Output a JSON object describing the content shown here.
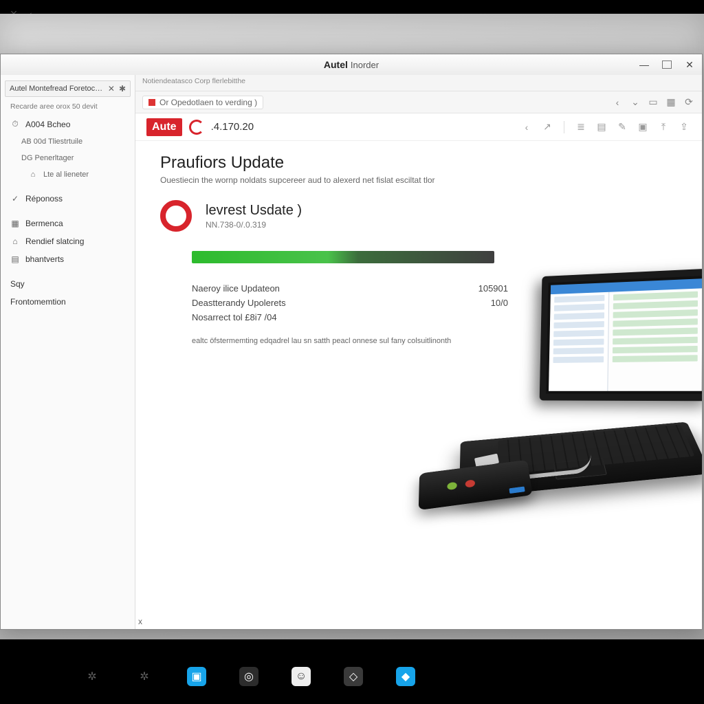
{
  "back_tabs": {
    "close": "✕",
    "collapse": "‹"
  },
  "window": {
    "brand": "Autel",
    "brand_sub": "Inorder",
    "buttons": {
      "min": "—",
      "max": "",
      "close": "✕"
    }
  },
  "sidebar": {
    "tab_title": "Autel Montefread Foretoctic Aute",
    "tab_close": "✕",
    "tab_pin": "✱",
    "caption": "Recarde aree orox 50 devit",
    "items": [
      {
        "icon": "⏱",
        "label": "A004 Bcheo"
      },
      {
        "icon": "",
        "label": "AB 00d Tliestrtuile",
        "sub": true
      },
      {
        "icon": "",
        "label": "DG Penerltager",
        "sub": true
      },
      {
        "icon": "⌂",
        "label": "Lte al lieneter",
        "sub": true,
        "indent": true
      },
      {
        "icon": "✓",
        "label": "Réponoss"
      },
      {
        "icon": "▦",
        "label": "Bermenca"
      },
      {
        "icon": "⌂",
        "label": "Rendief slatcing"
      },
      {
        "icon": "▤",
        "label": "bhantverts"
      },
      {
        "icon": "",
        "label": "Sqy",
        "plain": true
      },
      {
        "icon": "",
        "label": "Frontomemtion",
        "plain": true
      }
    ]
  },
  "pane": {
    "tab_row": "Notiendeatasco Corp flerlebitthe",
    "addr": {
      "chip_label": "Or Opedotlaen to verding )",
      "icons": [
        "‹",
        "⌄",
        "▭",
        "▦",
        "⟳"
      ]
    },
    "toolbar": {
      "brand": "Aute",
      "version": ".4.170.20",
      "icons": [
        "‹",
        "↗",
        "≣",
        "▤",
        "✎",
        "▣",
        "⤒",
        "⇪"
      ]
    },
    "content": {
      "heading": "Praufiors Update",
      "subtitle": "Ouestiecin the wornp noldats supcereer aud to alexerd net fislat esciltat tlor",
      "update_title": "levrest Usdate )",
      "update_version": "NN.738-0/.0.319",
      "progress_pct": 48,
      "stats": [
        {
          "label": "Naeroy ilice Updateon",
          "value": "105901"
        },
        {
          "label": "Deastterandy Upolerets",
          "value": "10/0"
        },
        {
          "label": "Nosarrect tol £8i7 /04",
          "value": ""
        }
      ],
      "note": "ealtc öfstermemting edqadrel lau sn satth peacl onnese sul fany colsuitlinonth",
      "bottom_x": "x"
    }
  },
  "taskbar": {
    "items": [
      {
        "cls": "dim",
        "glyph": "✲"
      },
      {
        "cls": "dim",
        "glyph": "✲"
      },
      {
        "cls": "blue",
        "glyph": "▣"
      },
      {
        "cls": "dark",
        "glyph": "◎"
      },
      {
        "cls": "light",
        "glyph": "☺"
      },
      {
        "cls": "grey",
        "glyph": "◇"
      },
      {
        "cls": "blue",
        "glyph": "◆"
      }
    ]
  },
  "colors": {
    "accent_red": "#d8242c",
    "progress_green": "#2dbb2d"
  }
}
